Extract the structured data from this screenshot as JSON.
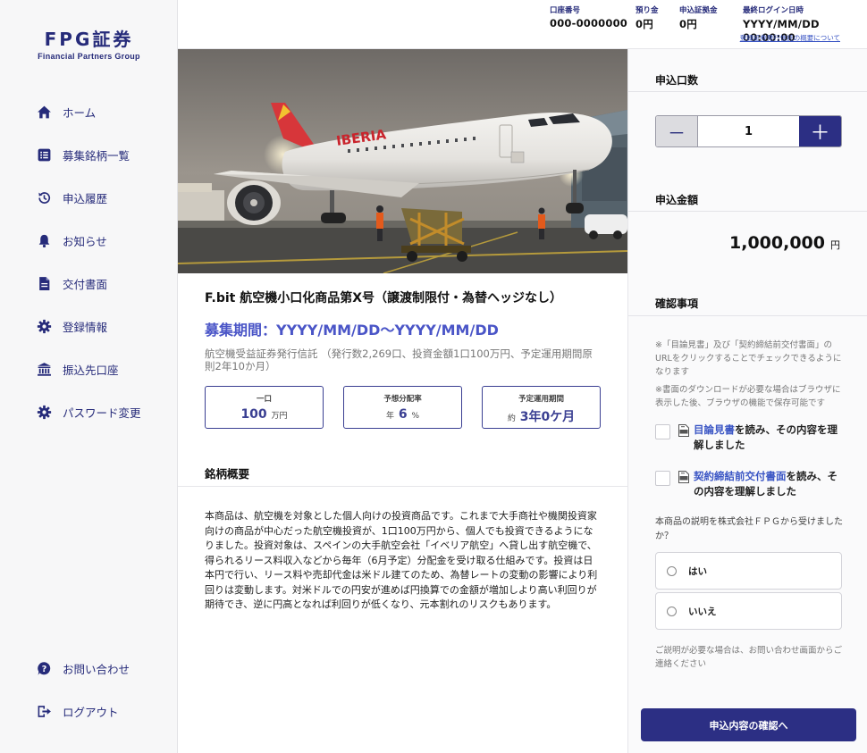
{
  "brand": {
    "name": "FPG証券",
    "subtitle": "Financial Partners Group"
  },
  "sidebar": {
    "items": [
      {
        "label": "ホーム",
        "icon": "home-icon"
      },
      {
        "label": "募集銘柄一覧",
        "icon": "list-icon"
      },
      {
        "label": "申込履歴",
        "icon": "history-icon"
      },
      {
        "label": "お知らせ",
        "icon": "bell-icon"
      },
      {
        "label": "交付書面",
        "icon": "document-icon"
      },
      {
        "label": "登録情報",
        "icon": "gear-icon"
      },
      {
        "label": "振込先口座",
        "icon": "bank-icon"
      },
      {
        "label": "パスワード変更",
        "icon": "gear-icon"
      }
    ],
    "bottom_items": [
      {
        "label": "お問い合わせ",
        "icon": "help-icon"
      },
      {
        "label": "ログアウト",
        "icon": "logout-icon"
      }
    ]
  },
  "header": {
    "account_label": "口座番号",
    "account_value": "000-0000000",
    "deposit_label": "預り金",
    "deposit_value": "0円",
    "margin_label": "申込証拠金",
    "margin_value": "0円",
    "login_label": "最終ログイン日時",
    "login_value": "YYYY/MM/DD　00:00:00",
    "policy_link": "登録証券発行信託の概要について"
  },
  "product": {
    "title": "F.bit 航空機小口化商品第X号（譲渡制限付・為替ヘッジなし）",
    "period": "募集期間：YYYY/MM/DD～YYYY/MM/DD",
    "description": "航空機受益証券発行信託 （発行数2,269口、投資金額1口100万円、予定運用期間原則2年10か月）",
    "boxes": [
      {
        "label": "一口",
        "prefix": "",
        "value": "100",
        "unit": "万円"
      },
      {
        "label": "予想分配率",
        "prefix": "年",
        "value": "6",
        "unit": "%"
      },
      {
        "label": "予定運用期間",
        "prefix": "約",
        "value": "3年0ケ月",
        "unit": ""
      }
    ],
    "overview_title": "銘柄概要",
    "overview_text": "本商品は、航空機を対象とした個人向けの投資商品です。これまで大手商社や機関投資家向けの商品が中心だった航空機投資が、1口100万円から、個人でも投資できるようになりました。投資対象は、スペインの大手航空会社「イベリア航空」へ貸し出す航空機で、得られるリース料収入などから毎年（6月予定）分配金を受け取る仕組みです。投資は日本円で行い、リース料や売却代金は米ドル建てのため、為替レートの変動の影響により利回りは変動します。対米ドルでの円安が進めば円換算での金額が増加しより高い利回りが期待でき、逆に円高となれば利回りが低くなり、元本割れのリスクもあります。",
    "livery_text": "IBERIA"
  },
  "order": {
    "units_title": "申込口数",
    "units_value": "1",
    "minus_label": "－",
    "plus_label": "＋",
    "amount_title": "申込金額",
    "amount_value": "1,000,000",
    "amount_unit": "円",
    "confirm_title": "確認事項",
    "note1": "※「目論見書」及び「契約締結前交付書面」のURLをクリックすることでチェックできるようになります",
    "note2": "※書面のダウンロードが必要な場合はブラウザに表示した後、ブラウザの機能で保存可能です",
    "check1_link": "目論見書",
    "check1_text": "を読み、その内容を理解しました",
    "check2_link": "契約締結前交付書面",
    "check2_text": "を読み、その内容を理解しました",
    "question": "本商品の説明を株式会社ＦＰＧから受けましたか？",
    "option_yes": "はい",
    "option_no": "いいえ",
    "help_note": "ご説明が必要な場合は、お問い合わせ画面からご連絡ください",
    "confirm_button": "申込内容の確認へ"
  }
}
